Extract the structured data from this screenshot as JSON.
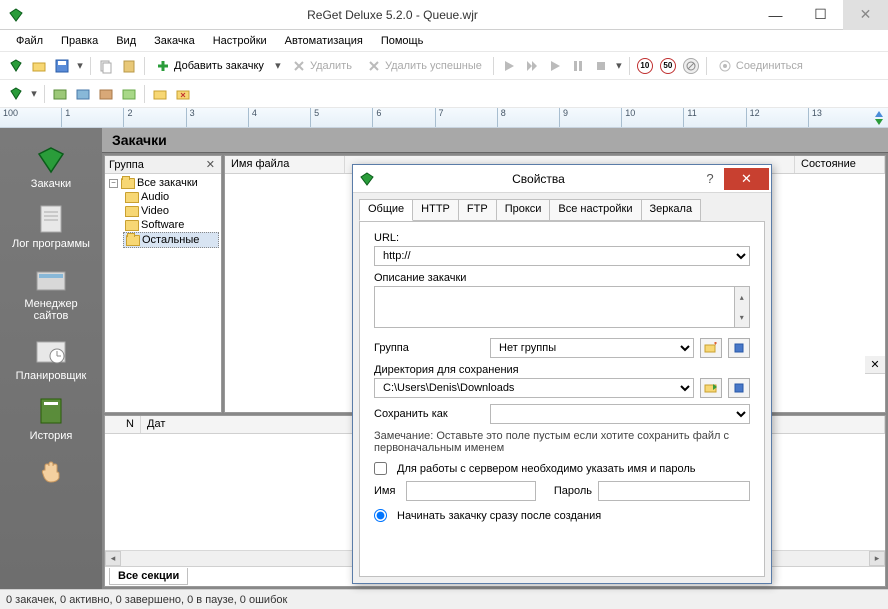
{
  "window": {
    "title": "ReGet Deluxe 5.2.0 - Queue.wjr"
  },
  "menu": [
    "Файл",
    "Правка",
    "Вид",
    "Закачка",
    "Настройки",
    "Автоматизация",
    "Помощь"
  ],
  "toolbar": {
    "add_download": "Добавить закачку",
    "delete": "Удалить",
    "delete_successful": "Удалить успешные",
    "connect": "Соединиться",
    "speed_10": "10",
    "speed_50": "50"
  },
  "ruler": [
    "100",
    "1",
    "2",
    "3",
    "4",
    "5",
    "6",
    "7",
    "8",
    "9",
    "10",
    "11",
    "12",
    "13"
  ],
  "sidebar": [
    {
      "label": "Закачки",
      "icon": "downloads"
    },
    {
      "label": "Лог программы",
      "icon": "log"
    },
    {
      "label": "Менеджер сайтов",
      "icon": "sites"
    },
    {
      "label": "Планировщик",
      "icon": "scheduler"
    },
    {
      "label": "История",
      "icon": "history"
    },
    {
      "label": "",
      "icon": "hand"
    }
  ],
  "section_title": "Закачки",
  "tree": {
    "header": "Группа",
    "root": "Все закачки",
    "children": [
      "Audio",
      "Video",
      "Software",
      "Остальные"
    ]
  },
  "list_columns": [
    "Имя файла",
    "Состояние"
  ],
  "bottom_columns": [
    "N",
    "Дат"
  ],
  "bottom_tab": "Все секции",
  "statusbar": "0 закачек, 0 активно, 0 завершено, 0 в паузе, 0 ошибок",
  "dialog": {
    "title": "Свойства",
    "tabs": [
      "Общие",
      "HTTP",
      "FTP",
      "Прокси",
      "Все настройки",
      "Зеркала"
    ],
    "url_label": "URL:",
    "url_value": "http://",
    "desc_label": "Описание закачки",
    "group_label": "Группа",
    "group_value": "Нет группы",
    "dir_label": "Директория для сохранения",
    "dir_value": "C:\\Users\\Denis\\Downloads",
    "saveas_label": "Сохранить как",
    "note": "Замечание: Оставьте это поле пустым если хотите сохранить файл с первоначальным именем",
    "auth_label": "Для работы с сервером необходимо указать имя и пароль",
    "name_label": "Имя",
    "pass_label": "Пароль",
    "start_now": "Начинать закачку сразу после создания"
  }
}
